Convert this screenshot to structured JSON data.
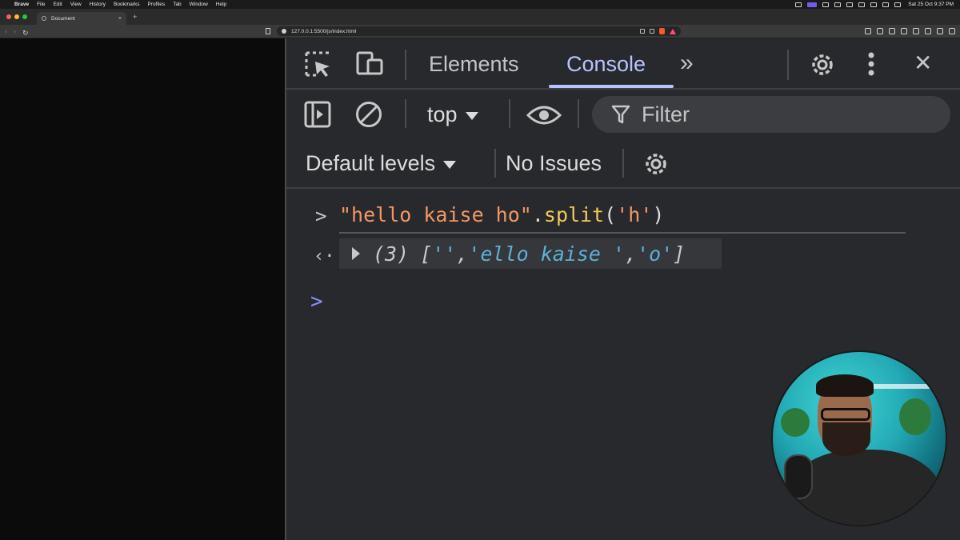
{
  "menubar": {
    "app": "Brave",
    "items": [
      "File",
      "Edit",
      "View",
      "History",
      "Bookmarks",
      "Profiles",
      "Tab",
      "Window",
      "Help"
    ],
    "clock": "Sat 25 Oct  9:37 PM"
  },
  "browser": {
    "tab_title": "Document",
    "tab_close": "×",
    "new_tab": "+",
    "url": "127.0.0.1:5500/js/index.html",
    "traffic_lights": [
      "#ff5f57",
      "#febc2e",
      "#28c840"
    ]
  },
  "devtools": {
    "tabs": [
      "Elements",
      "Console"
    ],
    "active_tab": "Console",
    "more_tabs": "»",
    "close": "✕",
    "context": "top",
    "filter_placeholder": "Filter",
    "levels": "Default levels",
    "issues": "No Issues",
    "accent": "#b7c3ff"
  },
  "console": {
    "input": {
      "prompt": ">",
      "string": "\"hello kaise ho\"",
      "dot": ".",
      "method": "split",
      "open": "(",
      "arg": "'h'",
      "close": ")"
    },
    "result": {
      "return_icon": "‹·",
      "count": "(3)",
      "open": "[",
      "items": [
        "''",
        "'ello kaise '",
        "'o'"
      ],
      "sep1": ", ",
      "sep2": ", ",
      "close": "]"
    },
    "cursor": ">"
  },
  "icons": {
    "inspect": "inspect-element-icon",
    "device": "device-toolbar-icon",
    "settings": "gear-icon",
    "menu": "kebab-menu-icon",
    "sidebar": "sidebar-toggle-icon",
    "clear": "clear-console-icon",
    "eye": "live-expression-icon",
    "filter": "filter-icon"
  }
}
